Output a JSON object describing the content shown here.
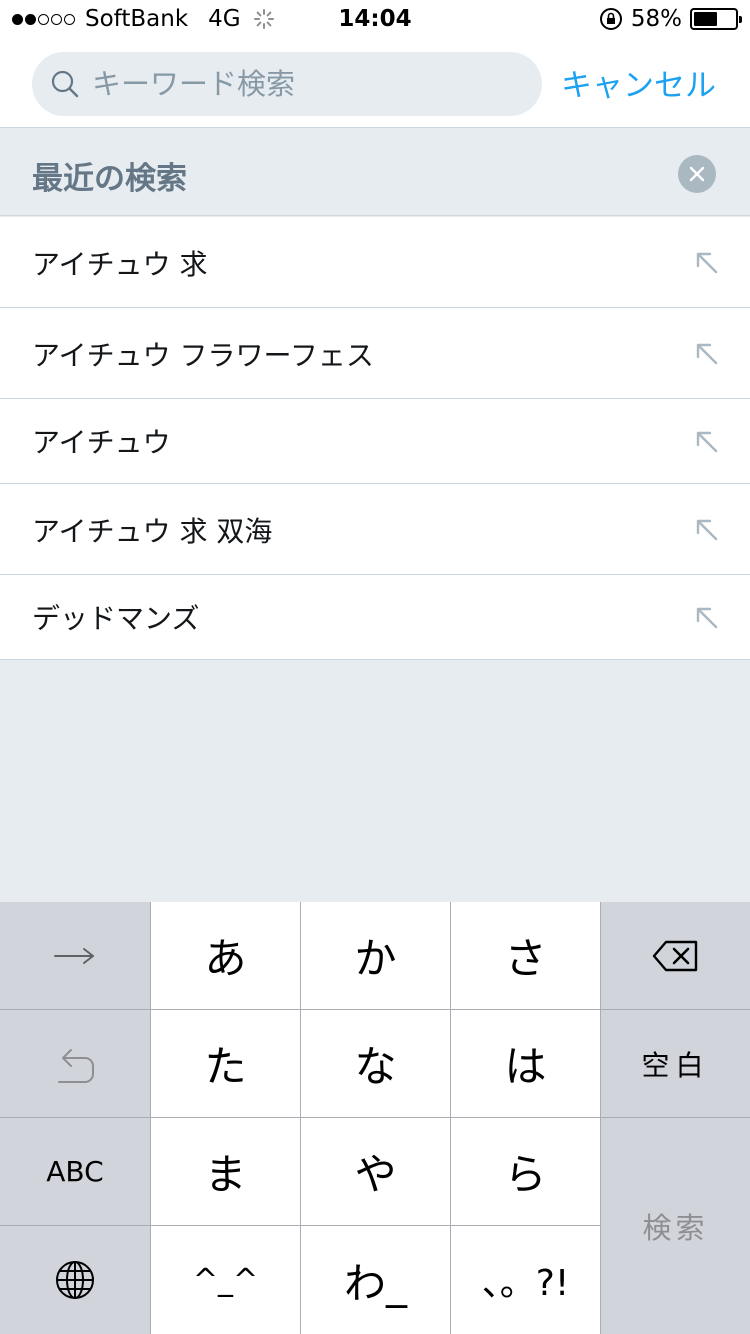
{
  "status_bar": {
    "carrier": "SoftBank",
    "network": "4G",
    "time": "14:04",
    "battery_percent": "58%",
    "battery_level": 0.58,
    "signal_bars": 2
  },
  "search": {
    "placeholder": "キーワード検索",
    "value": "",
    "cancel_label": "キャンセル"
  },
  "recent": {
    "title": "最近の検索",
    "items": [
      {
        "label": "アイチュウ 求"
      },
      {
        "label": "アイチュウ フラワーフェス"
      },
      {
        "label": "アイチュウ"
      },
      {
        "label": "アイチュウ 求 双海"
      },
      {
        "label": "デッドマンズ"
      }
    ]
  },
  "keyboard": {
    "keys": {
      "a": "あ",
      "ka": "か",
      "sa": "さ",
      "ta": "た",
      "na": "な",
      "ha": "は",
      "ma": "ま",
      "ya": "や",
      "ra": "ら",
      "emoticon": "^_^",
      "wa": "わ_",
      "punct": "、。?!",
      "space": "空白",
      "abc": "ABC",
      "search": "検索"
    }
  },
  "colors": {
    "accent": "#1da1f2",
    "background": "#e6ecf0",
    "secondary_text": "#657786",
    "placeholder": "#8899a6",
    "divider": "#ccd6dd"
  }
}
